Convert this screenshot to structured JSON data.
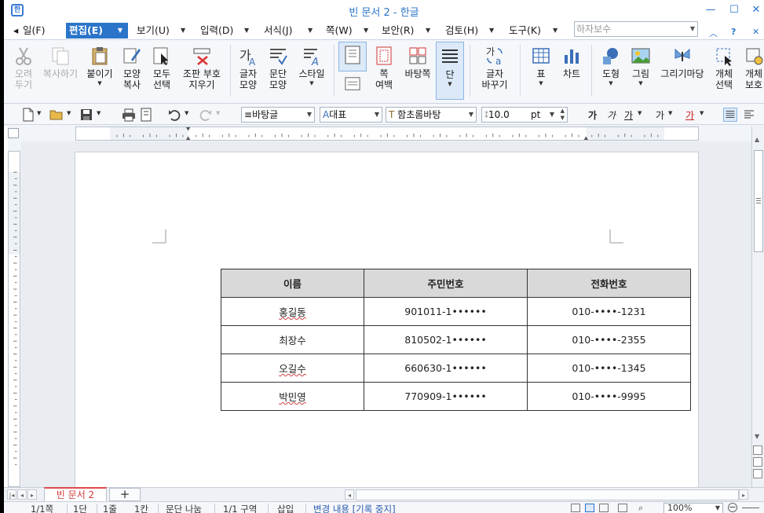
{
  "title_bar": {
    "title": "빈 문서 2 - 한글",
    "logo": "hangul-logo",
    "min": "—",
    "max": "☐",
    "close": "✕"
  },
  "menu": {
    "items": [
      {
        "label": "일(F)",
        "name": "menu-file"
      },
      {
        "label": "편집(E)",
        "name": "menu-edit",
        "active": true
      },
      {
        "label": "보기(U)",
        "name": "menu-view"
      },
      {
        "label": "입력(D)",
        "name": "menu-input"
      },
      {
        "label": "서식(J)",
        "name": "menu-format"
      },
      {
        "label": "쪽(W)",
        "name": "menu-page"
      },
      {
        "label": "보안(R)",
        "name": "menu-security"
      },
      {
        "label": "검토(H)",
        "name": "menu-review"
      },
      {
        "label": "도구(K)",
        "name": "menu-tools"
      }
    ],
    "hanja_placeholder": "하자보수"
  },
  "ribbon": {
    "cut": "오려\n두기",
    "copy": "복사하기",
    "paste": "붙이기",
    "format_copy": "모양\n복사",
    "select_all": "모두\n선택",
    "delete_combo": "조판 부호\n지우기",
    "char_shape": "글자\n모양",
    "para_shape": "문단\n모양",
    "style": "스타일",
    "page_margin": "쪽\n여백",
    "background_page": "바탕쪽",
    "column": "단",
    "char_change": "글자\n바꾸기",
    "table": "표",
    "chart": "차트",
    "shape": "도형",
    "picture": "그림",
    "draw": "그리기마당",
    "obj_select": "개체\n선택",
    "obj_protect": "개체\n보호"
  },
  "toolbar": {
    "style_combo": "바탕글",
    "lang_combo": "대표",
    "font_combo": "함초롬바탕",
    "size_value": "10.0",
    "size_unit": "pt",
    "bold": "가",
    "italic": "가",
    "underline": "가",
    "strike": "가",
    "color": "가"
  },
  "document": {
    "headers": [
      "이름",
      "주민번호",
      "전화번호"
    ],
    "rows": [
      [
        "홍길동",
        "901011-1••••••",
        "010-••••-1231"
      ],
      [
        "최장수",
        "810502-1••••••",
        "010-••••-2355"
      ],
      [
        "오길수",
        "660630-1••••••",
        "010-••••-1345"
      ],
      [
        "박민영",
        "770909-1••••••",
        "010-••••-9995"
      ]
    ]
  },
  "tabs": {
    "doc_tab": "빈 문서 2",
    "add": "+"
  },
  "status": {
    "page": "1/1쪽",
    "section": "1단",
    "line": "1줄",
    "col": "1칸",
    "para_div": "문단 나눔",
    "cursor": "1/1 구역",
    "mode": "삽입",
    "track": "변경 내용 [기록 중지]",
    "zoom": "100%"
  }
}
